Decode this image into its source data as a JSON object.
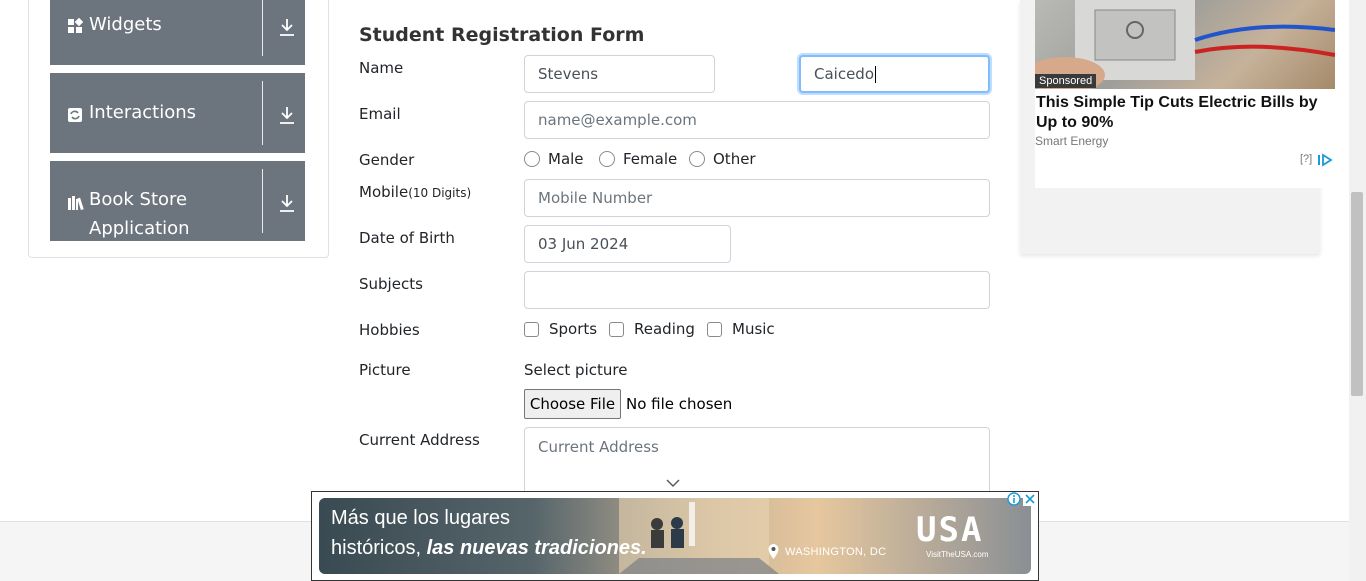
{
  "sidebar": {
    "groups": [
      {
        "label": "Widgets",
        "icon": "widgets-icon"
      },
      {
        "label": "Interactions",
        "icon": "interactions-icon"
      },
      {
        "label": "Book Store",
        "label2": "Application",
        "icon": "book-store-icon"
      }
    ]
  },
  "form": {
    "title": "Student Registration Form",
    "name_label": "Name",
    "first_name_value": "Stevens",
    "last_name_value": "Caicedo",
    "email_label": "Email",
    "email_placeholder": "name@example.com",
    "gender_label": "Gender",
    "gender_options": [
      "Male",
      "Female",
      "Other"
    ],
    "mobile_label": "Mobile",
    "mobile_hint": "(10 Digits)",
    "mobile_placeholder": "Mobile Number",
    "dob_label": "Date of Birth",
    "dob_value": "03 Jun 2024",
    "subjects_label": "Subjects",
    "hobbies_label": "Hobbies",
    "hobby_options": [
      "Sports",
      "Reading",
      "Music"
    ],
    "picture_label": "Picture",
    "select_picture_text": "Select picture",
    "choose_file_label": "Choose File",
    "no_file_text": "No file chosen",
    "address_label": "Current Address",
    "address_placeholder": "Current Address"
  },
  "right_ad": {
    "badge": "Sponsored",
    "headline": "This Simple Tip Cuts Electric Bills by Up to 90%",
    "source": "Smart Energy",
    "help": "[?]"
  },
  "bottom_ad": {
    "line1": "Más que los lugares",
    "line2_normal": "históricos, ",
    "line2_bold": "las nuevas tradiciones.",
    "location": "WASHINGTON, DC",
    "logo": "USA",
    "logo_sub": "VisitTheUSA.com"
  },
  "colors": {
    "sidebar_bg": "#6c757d",
    "input_border": "#ced4da",
    "focus_border": "#80bdff"
  }
}
